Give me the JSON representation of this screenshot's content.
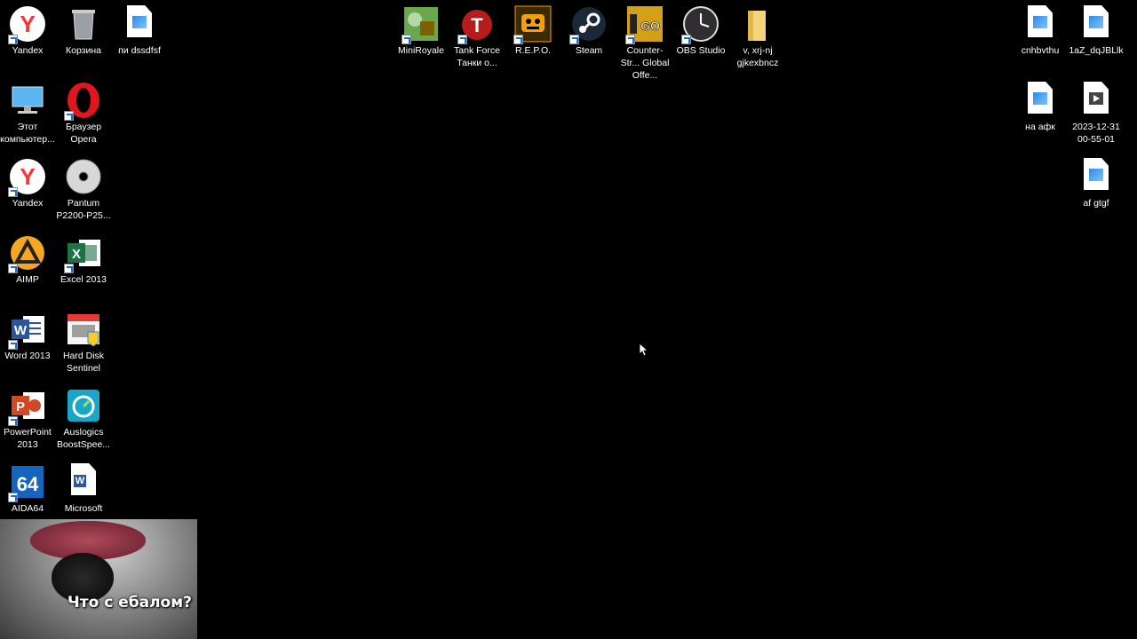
{
  "desktop": {
    "left_column_1": [
      {
        "label": "Yandex",
        "icon": "yandex-browser-icon"
      },
      {
        "label": "Этот компьютер...",
        "icon": "this-pc-icon"
      },
      {
        "label": "Yandex",
        "icon": "yandex-browser-icon"
      },
      {
        "label": "AIMP",
        "icon": "aimp-icon"
      },
      {
        "label": "Word 2013",
        "icon": "word-icon"
      },
      {
        "label": "PowerPoint 2013",
        "icon": "powerpoint-icon"
      },
      {
        "label": "AIDA64",
        "icon": "aida64-icon"
      }
    ],
    "left_column_2": [
      {
        "label": "Корзина",
        "icon": "recycle-bin-icon"
      },
      {
        "label": "Браузер Opera",
        "icon": "opera-icon"
      },
      {
        "label": "Pantum P2200-P25...",
        "icon": "cd-disc-icon"
      },
      {
        "label": "Excel 2013",
        "icon": "excel-icon"
      },
      {
        "label": "Hard Disk Sentinel",
        "icon": "hard-disk-sentinel-icon"
      },
      {
        "label": "Auslogics BoostSpee...",
        "icon": "auslogics-icon"
      },
      {
        "label": "Microsoft",
        "icon": "word-document-icon"
      }
    ],
    "left_column_3": [
      {
        "label": "пи dssdfsf",
        "icon": "image-file-icon"
      }
    ],
    "top_row": [
      {
        "label": "MiniRoyale",
        "icon": "miniroyale-icon"
      },
      {
        "label": "Tank Force Танки о...",
        "icon": "tank-force-icon"
      },
      {
        "label": "R.E.P.O.",
        "icon": "repo-game-icon"
      },
      {
        "label": "Steam",
        "icon": "steam-icon"
      },
      {
        "label": "Counter-Str... Global Offe...",
        "icon": "csgo-icon"
      },
      {
        "label": "OBS Studio",
        "icon": "obs-icon"
      },
      {
        "label": "v, xrj-nj gjkexbncz",
        "icon": "folder-icon"
      }
    ],
    "right_column_1": [
      {
        "label": "cnhbvthu",
        "icon": "image-file-icon"
      },
      {
        "label": "на афк",
        "icon": "image-file-icon"
      }
    ],
    "right_column_2": [
      {
        "label": "1aZ_dqJBLlk",
        "icon": "image-file-icon"
      },
      {
        "label": "2023-12-31 00-55-01",
        "icon": "video-file-icon"
      },
      {
        "label": "af gtgf",
        "icon": "image-file-icon"
      }
    ]
  },
  "overlay": {
    "caption": "Что с ебалом?"
  },
  "colors": {
    "background": "#000000",
    "label": "#ffffff",
    "yandex": "#ff3333",
    "opera": "#e0161f",
    "excel": "#1f7244",
    "word": "#2b579a",
    "powerpoint": "#d24726",
    "steam": "#1b2838",
    "aimp": "#f5a623",
    "folder": "#f3d57c"
  }
}
